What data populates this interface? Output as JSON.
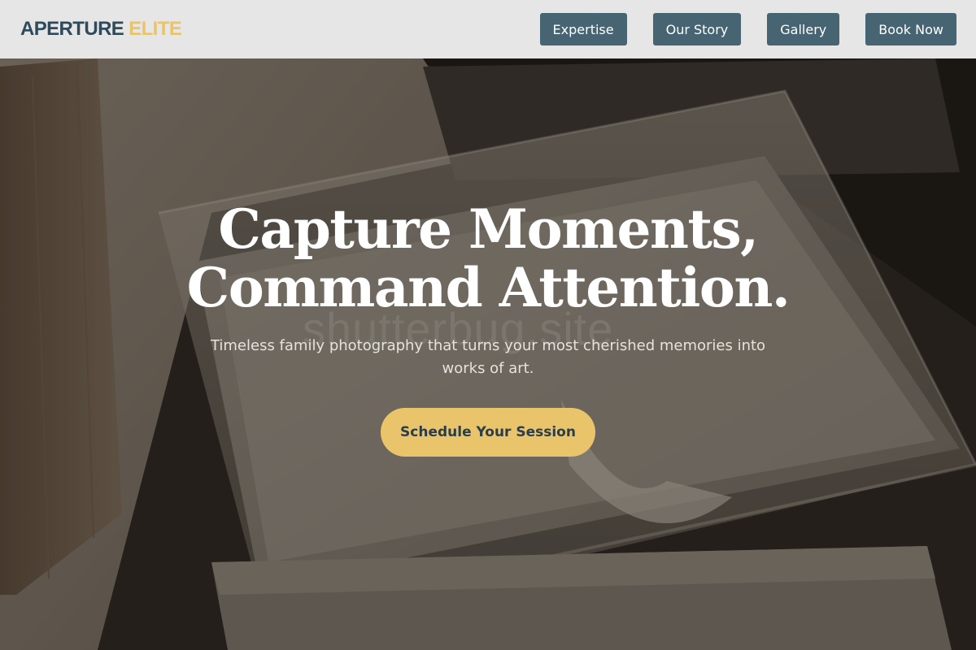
{
  "brand": {
    "name_primary": "APERTURE",
    "name_accent": "ELITE",
    "accent_color": "#e9c46a",
    "primary_color": "#2f4a5a"
  },
  "nav": {
    "items": [
      {
        "label": "Expertise"
      },
      {
        "label": "Our Story"
      },
      {
        "label": "Gallery"
      },
      {
        "label": "Book Now"
      }
    ],
    "button_color": "#476472"
  },
  "hero": {
    "title_line_1": "Capture Moments,",
    "title_line_2": "Command Attention.",
    "subtitle": "Timeless family photography that turns your most cherished memories into works of art.",
    "cta_label": "Schedule Your Session",
    "background_image": "acrylic-photo-box-photo",
    "watermark_text": "shutterbug.site"
  }
}
